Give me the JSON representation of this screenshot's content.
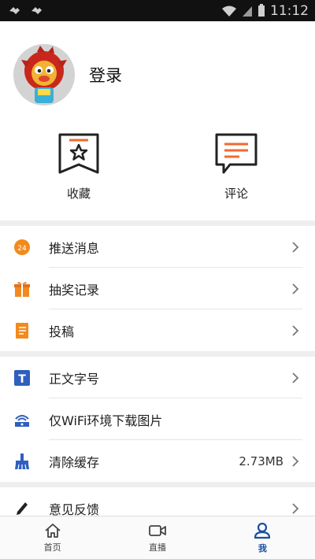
{
  "status_bar": {
    "time": "11:12"
  },
  "profile": {
    "login_label": "登录"
  },
  "shortcuts": [
    {
      "label": "收藏",
      "icon": "bookmark-star-icon"
    },
    {
      "label": "评论",
      "icon": "comment-icon"
    }
  ],
  "menu_groups": [
    [
      {
        "label": "推送消息",
        "icon": "push-24-icon"
      },
      {
        "label": "抽奖记录",
        "icon": "gift-icon"
      },
      {
        "label": "投稿",
        "icon": "notebook-icon"
      }
    ],
    [
      {
        "label": "正文字号",
        "icon": "font-size-icon"
      },
      {
        "label": "仅WiFi环境下载图片",
        "icon": "wifi-download-icon"
      },
      {
        "label": "清除缓存",
        "icon": "broom-icon",
        "value": "2.73MB"
      }
    ],
    [
      {
        "label": "意见反馈",
        "icon": "pencil-icon"
      }
    ]
  ],
  "tabbar": [
    {
      "label": "首页",
      "icon": "home-icon"
    },
    {
      "label": "直播",
      "icon": "video-icon"
    },
    {
      "label": "我",
      "icon": "person-icon",
      "active": true
    }
  ],
  "colors": {
    "accent": "#1a4fa0",
    "orange": "#f28a1e",
    "icon_blue": "#2f5fbf"
  }
}
